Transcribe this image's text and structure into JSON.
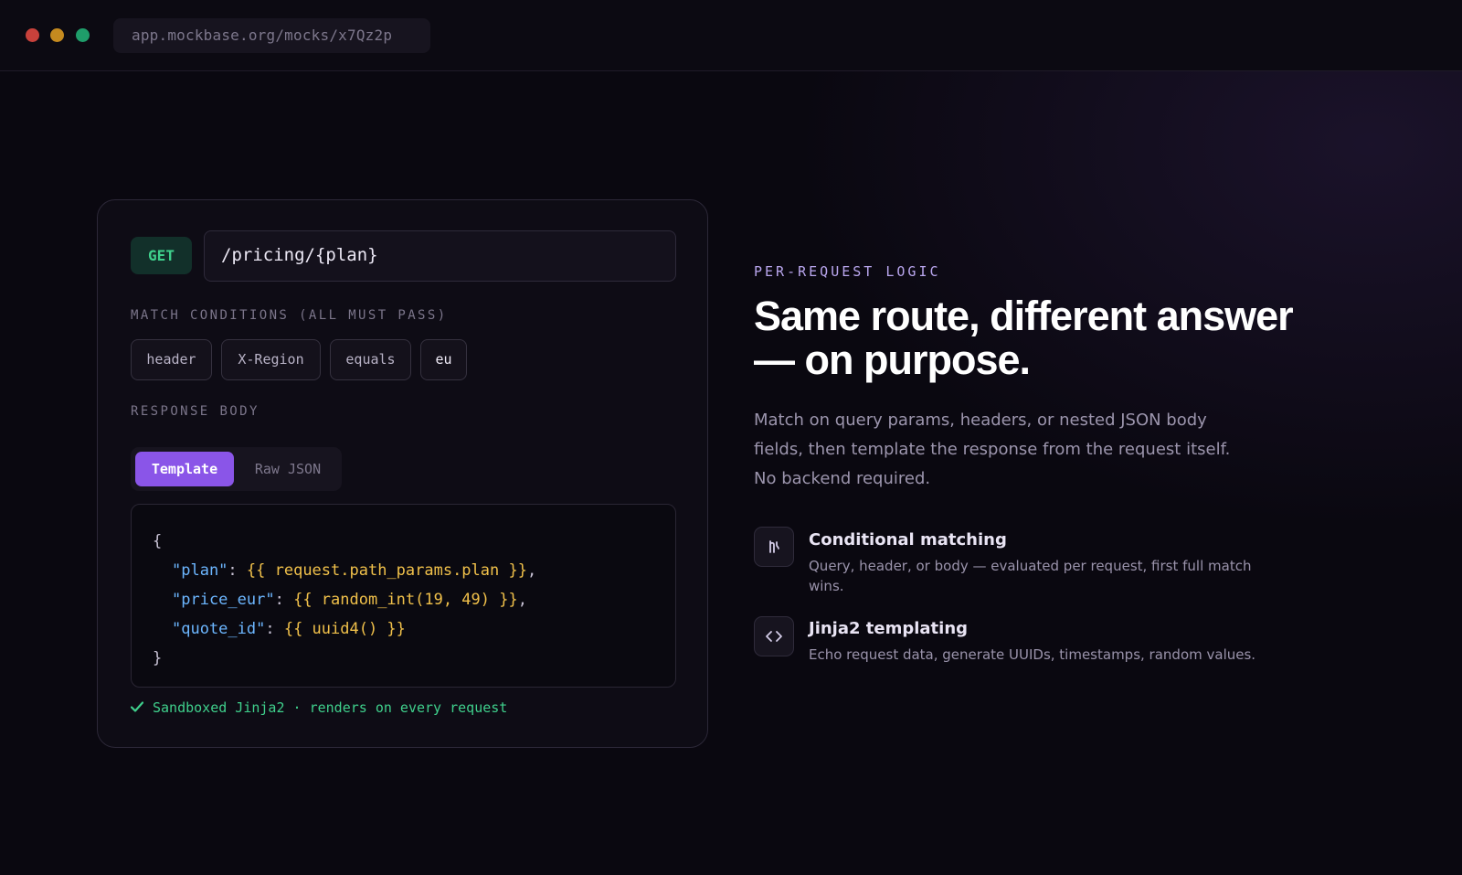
{
  "browser": {
    "url": "app.mockbase.org/mocks/x7Qz2p"
  },
  "editor": {
    "method": "GET",
    "path": "/pricing/{plan}",
    "match_label": "MATCH CONDITIONS (ALL MUST PASS)",
    "conditions": [
      "header",
      "X-Region",
      "equals",
      "eu"
    ],
    "response_label": "RESPONSE BODY",
    "tabs": {
      "active": "Template",
      "inactive": "Raw JSON"
    },
    "code": {
      "open": "{",
      "lines": [
        {
          "key": "\"plan\"",
          "colon": ": ",
          "value": "{{ request.path_params.plan }}",
          "tail": ","
        },
        {
          "key": "\"price_eur\"",
          "colon": ": ",
          "value": "{{ random_int(19, 49) }}",
          "tail": ","
        },
        {
          "key": "\"quote_id\"",
          "colon": ": ",
          "value": "{{ uuid4() }}",
          "tail": ""
        }
      ],
      "close": "}"
    },
    "status": "Sandboxed Jinja2 · renders on every request"
  },
  "hero": {
    "eyebrow": "PER-REQUEST LOGIC",
    "headline_line1": "Same route, different answer",
    "headline_line2": "— on purpose.",
    "description": "Match on query params, headers, or nested JSON body fields, then template the response from the request itself. No backend required."
  },
  "features": [
    {
      "icon": "branch-icon",
      "title": "Conditional matching",
      "description": "Query, header, or body — evaluated per request, first full match wins."
    },
    {
      "icon": "code-brackets-icon",
      "title": "Jinja2 templating",
      "description": "Echo request data, generate UUIDs, timestamps, random values."
    }
  ],
  "colors": {
    "accent": "#8a55e8",
    "success": "#3fd08c",
    "code_key": "#6cb6ff",
    "code_template": "#f0c04a"
  }
}
